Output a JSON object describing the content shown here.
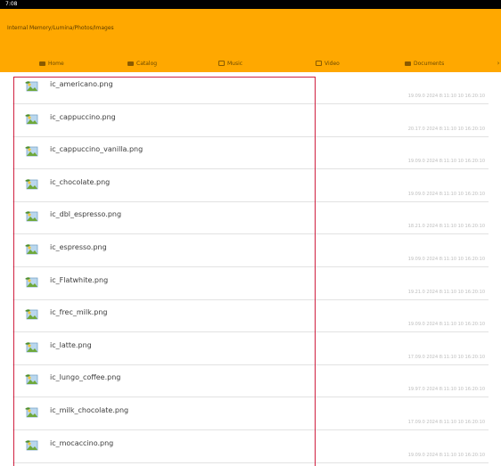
{
  "status": {
    "time": "7:08"
  },
  "header": {
    "path": "Internal Memory/Lumina/Photos/Images"
  },
  "tabs": [
    {
      "label": "Home",
      "icon": "home-icon"
    },
    {
      "label": "Catalog",
      "icon": "grid-icon"
    },
    {
      "label": "Music",
      "icon": "music-folder-icon"
    },
    {
      "label": "Video",
      "icon": "video-folder-icon"
    },
    {
      "label": "Documents",
      "icon": "documents-icon"
    }
  ],
  "files": [
    {
      "name": "ic_americano.png",
      "date": "19.09.0 2024 8:11:10 10 16:20:10"
    },
    {
      "name": "ic_cappuccino.png",
      "date": "20.17.0 2024 8:11:10 10 16:20:10"
    },
    {
      "name": "ic_cappuccino_vanilla.png",
      "date": "19.09.0 2024 8:11:10 10 16:20:10"
    },
    {
      "name": "ic_chocolate.png",
      "date": "19.09.0 2024 8:11:10 10 16:20:10"
    },
    {
      "name": "ic_dbl_espresso.png",
      "date": "18.21.0 2024 8:11:10 10 16:20:10"
    },
    {
      "name": "ic_espresso.png",
      "date": "19.09.0 2024 8:11:10 10 16:20:10"
    },
    {
      "name": "ic_Flatwhite.png",
      "date": "19.21.0 2024 8:11:10 10 16:20:10"
    },
    {
      "name": "ic_frec_milk.png",
      "date": "19.09.0 2024 8:11:10 10 16:20:10"
    },
    {
      "name": "ic_latte.png",
      "date": "17.09.0 2024 8:11:10 10 16:20:10"
    },
    {
      "name": "ic_lungo_coffee.png",
      "date": "19.97.0 2024 8:11:10 10 16:20:10"
    },
    {
      "name": "ic_milk_chocolate.png",
      "date": "17.09.0 2024 8:11:10 10 16:20:10"
    },
    {
      "name": "ic_mocaccino.png",
      "date": "19.09.0 2024 8:11:10 10 16:20:10"
    }
  ]
}
